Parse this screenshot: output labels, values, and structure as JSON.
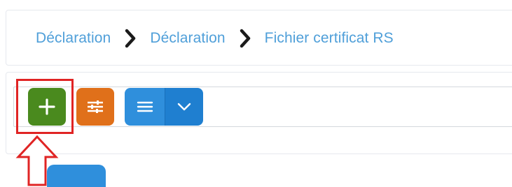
{
  "breadcrumb": {
    "items": [
      {
        "label": "Déclaration"
      },
      {
        "label": "Déclaration"
      },
      {
        "label": "Fichier certificat RS"
      }
    ]
  },
  "toolbar": {
    "buttons": [
      {
        "name": "add",
        "icon": "plus-icon",
        "color": "#4a8a1e"
      },
      {
        "name": "filter",
        "icon": "sliders-icon",
        "color": "#e0701a"
      },
      {
        "name": "list-view",
        "icon": "list-icon",
        "color": "#2f8fdc"
      },
      {
        "name": "list-view-dropdown",
        "icon": "chevron-down-icon",
        "color": "#1f7fd0"
      }
    ]
  },
  "annotation": {
    "highlight_color": "#e02424",
    "target": "add-button"
  }
}
